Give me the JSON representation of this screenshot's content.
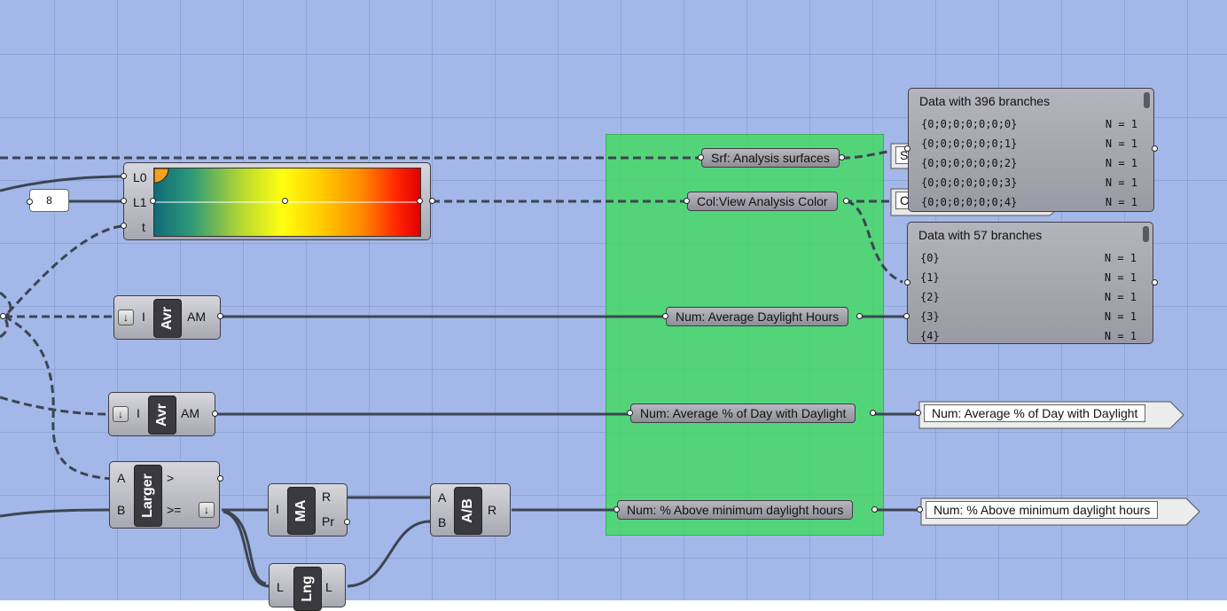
{
  "colors": {
    "canvas": "#a3b8e8",
    "group": "#4cd870",
    "component": "#b0b0b8",
    "wire": "#3d4452"
  },
  "slider": {
    "value": "8"
  },
  "gradient": {
    "inputs": [
      "L0",
      "L1",
      "t"
    ]
  },
  "avr1": {
    "in": "I",
    "icon": "Avr",
    "out": "AM",
    "arrow_icon": "arrow-down-icon"
  },
  "avr2": {
    "in": "I",
    "icon": "Avr",
    "out": "AM",
    "arrow_icon": "arrow-down-icon"
  },
  "larger": {
    "in_a": "A",
    "in_b": "B",
    "icon": "Larger",
    "out_gt": ">",
    "out_ge": ">="
  },
  "ma": {
    "in": "I",
    "icon": "MA",
    "out_r": "R",
    "out_pr": "Pr"
  },
  "div": {
    "in_a": "A",
    "in_b": "B",
    "icon": "A/B",
    "out": "R"
  },
  "lng": {
    "in": "L",
    "icon": "Lng",
    "out": "L"
  },
  "params": {
    "srf": "Srf: Analysis surfaces",
    "col": "Col:View Analysis Color",
    "avg_hours": "Num: Average Daylight Hours",
    "avg_pct": "Num: Average % of Day with Daylight",
    "above_min": "Num: % Above minimum daylight hours"
  },
  "panel1": {
    "title": "Data with 396 branches",
    "rows": [
      {
        "path": "{0;0;0;0;0;0;0}",
        "n": "N = 1"
      },
      {
        "path": "{0;0;0;0;0;0;1}",
        "n": "N = 1"
      },
      {
        "path": "{0;0;0;0;0;0;2}",
        "n": "N = 1"
      },
      {
        "path": "{0;0;0;0;0;0;3}",
        "n": "N = 1"
      },
      {
        "path": "{0;0;0;0;0;0;4}",
        "n": "N = 1"
      }
    ]
  },
  "panel2": {
    "title": "Data with 57 branches",
    "rows": [
      {
        "path": "{0}",
        "n": "N = 1"
      },
      {
        "path": "{1}",
        "n": "N = 1"
      },
      {
        "path": "{2}",
        "n": "N = 1"
      },
      {
        "path": "{3}",
        "n": "N = 1"
      },
      {
        "path": "{4}",
        "n": "N = 1"
      }
    ]
  },
  "tags": {
    "avg_pct": "Num: Average % of Day with Daylight",
    "above_min": "Num: % Above minimum daylight hours",
    "srf_partial": "S",
    "col_partial": "C"
  }
}
